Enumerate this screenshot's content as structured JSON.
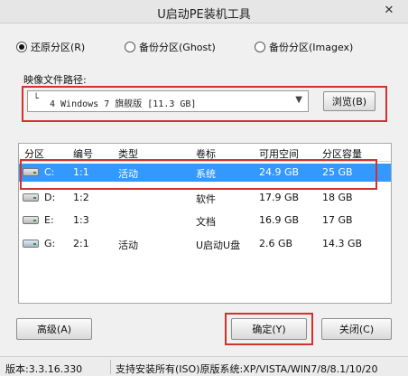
{
  "window": {
    "title": "U启动PE装机工具",
    "close_glyph": "✕"
  },
  "modes": [
    {
      "label": "还原分区(R)",
      "selected": true
    },
    {
      "label": "备份分区(Ghost)",
      "selected": false
    },
    {
      "label": "备份分区(Imagex)",
      "selected": false
    }
  ],
  "image": {
    "label": "映像文件路径:",
    "tree_glyph": "└",
    "value": "4 Windows 7 旗舰版 [11.3 GB]",
    "dropdown_glyph": "▼",
    "browse_label": "浏览(B)"
  },
  "table": {
    "columns": [
      "分区",
      "编号",
      "类型",
      "卷标",
      "可用空间",
      "分区容量"
    ],
    "rows": [
      {
        "drive": "C:",
        "number": "1:1",
        "type": "活动",
        "label": "系统",
        "free": "24.9 GB",
        "capacity": "25 GB",
        "selected": true,
        "icon": "hard-drive-icon"
      },
      {
        "drive": "D:",
        "number": "1:2",
        "type": "",
        "label": "软件",
        "free": "17.9 GB",
        "capacity": "18 GB",
        "selected": false,
        "icon": "hard-drive-icon"
      },
      {
        "drive": "E:",
        "number": "1:3",
        "type": "",
        "label": "文档",
        "free": "16.9 GB",
        "capacity": "17 GB",
        "selected": false,
        "icon": "hard-drive-icon"
      },
      {
        "drive": "G:",
        "number": "2:1",
        "type": "活动",
        "label": "U启动U盘",
        "free": "2.6 GB",
        "capacity": "14.3 GB",
        "selected": false,
        "icon": "usb-drive-icon"
      }
    ]
  },
  "buttons": {
    "advanced": "高级(A)",
    "confirm": "确定(Y)",
    "close": "关闭(C)"
  },
  "status": {
    "version": "版本:3.3.16.330",
    "support": "支持安装所有(ISO)原版系统:XP/VISTA/WIN7/8/8.1/10/20"
  },
  "colors": {
    "selection": "#3399ff",
    "highlight_box": "#d2322d"
  }
}
